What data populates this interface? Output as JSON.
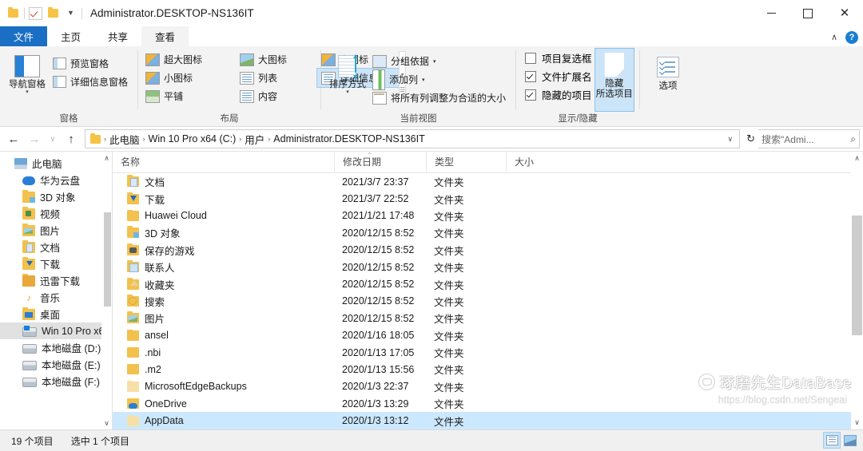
{
  "window": {
    "title": "Administrator.DESKTOP-NS136IT",
    "controls": {
      "minimize": "—",
      "maximize": "□",
      "close": "✕"
    }
  },
  "quick_access_toolbar": {
    "items": [
      "folder-icon",
      "properties-check-icon",
      "new-folder-icon",
      "customize-caret"
    ]
  },
  "tabs": [
    {
      "label": "文件",
      "name": "tab-file"
    },
    {
      "label": "主页",
      "name": "tab-home"
    },
    {
      "label": "共享",
      "name": "tab-share"
    },
    {
      "label": "查看",
      "name": "tab-view"
    }
  ],
  "tabstrip_right": {
    "collapse": "∧",
    "help": "?"
  },
  "ribbon": {
    "groups": [
      {
        "label": "窗格",
        "big_button": {
          "label": "导航窗格",
          "caret": "▾"
        },
        "small_items": [
          {
            "label": "预览窗格"
          },
          {
            "label": "详细信息窗格"
          }
        ]
      },
      {
        "label": "布局",
        "views": [
          {
            "label": "超大图标"
          },
          {
            "label": "大图标"
          },
          {
            "label": "中图标"
          },
          {
            "label": "小图标"
          },
          {
            "label": "列表"
          },
          {
            "label": "详细信息"
          },
          {
            "label": "平铺"
          },
          {
            "label": "内容"
          }
        ],
        "selected_view": "详细信息",
        "scroll": {
          "up": "▴",
          "down": "▾",
          "more": "☰"
        }
      },
      {
        "label": "当前视图",
        "big_button": {
          "label": "排序方式",
          "caret": "▾"
        },
        "small_items": [
          {
            "label": "分组依据",
            "caret": "▾"
          },
          {
            "label": "添加列",
            "caret": "▾"
          },
          {
            "label": "将所有列调整为合适的大小",
            "caret": ""
          }
        ]
      },
      {
        "label": "显示/隐藏",
        "checkboxes": [
          {
            "label": "项目复选框",
            "checked": false
          },
          {
            "label": "文件扩展名",
            "checked": true
          },
          {
            "label": "隐藏的项目",
            "checked": true
          }
        ],
        "hide_button": {
          "line1": "隐藏",
          "line2": "所选项目"
        }
      },
      {
        "label": "",
        "options_button": {
          "label": "选项"
        }
      }
    ]
  },
  "address_bar": {
    "back": "←",
    "forward": "→",
    "recent": "∨",
    "up": "↑",
    "breadcrumbs": [
      "此电脑",
      "Win 10 Pro x64 (C:)",
      "用户",
      "Administrator.DESKTOP-NS136IT"
    ],
    "separator": "›",
    "dropdown_caret": "∨",
    "refresh": "↻",
    "search_value": "搜索\"Admi...",
    "search_icon": "⌕"
  },
  "sidebar": {
    "items": [
      {
        "label": "此电脑",
        "icon": "pc-icon",
        "indent": false,
        "selected": false
      },
      {
        "label": "华为云盘",
        "icon": "cloud-icon",
        "indent": true,
        "selected": false
      },
      {
        "label": "3D 对象",
        "icon": "folder-3d-icon",
        "indent": true,
        "selected": false
      },
      {
        "label": "视频",
        "icon": "folder-video-icon",
        "indent": true,
        "selected": false
      },
      {
        "label": "图片",
        "icon": "folder-pictures-icon",
        "indent": true,
        "selected": false
      },
      {
        "label": "文档",
        "icon": "folder-documents-icon",
        "indent": true,
        "selected": false
      },
      {
        "label": "下载",
        "icon": "folder-downloads-icon",
        "indent": true,
        "selected": false
      },
      {
        "label": "迅雷下载",
        "icon": "folder-thunder-icon",
        "indent": true,
        "selected": false
      },
      {
        "label": "音乐",
        "icon": "music-icon",
        "indent": true,
        "selected": false
      },
      {
        "label": "桌面",
        "icon": "folder-desktop-icon",
        "indent": true,
        "selected": false
      },
      {
        "label": "Win 10 Pro x6",
        "icon": "drive-windows-icon",
        "indent": true,
        "selected": true
      },
      {
        "label": "本地磁盘 (D:)",
        "icon": "drive-icon",
        "indent": true,
        "selected": false
      },
      {
        "label": "本地磁盘 (E:)",
        "icon": "drive-icon",
        "indent": true,
        "selected": false
      },
      {
        "label": "本地磁盘 (F:)",
        "icon": "drive-icon",
        "indent": true,
        "selected": false
      }
    ],
    "scroll_up": "∧",
    "scroll_down": "∨"
  },
  "file_list": {
    "columns": [
      {
        "label": "名称",
        "key": "name"
      },
      {
        "label": "修改日期",
        "key": "date"
      },
      {
        "label": "类型",
        "key": "type"
      },
      {
        "label": "大小",
        "key": "size"
      }
    ],
    "sort_indicator": "⌃",
    "rows": [
      {
        "name": "文档",
        "date": "2021/3/7 23:37",
        "type": "文件夹",
        "size": "",
        "icon": "folder-documents-icon",
        "selected": false
      },
      {
        "name": "下载",
        "date": "2021/3/7 22:52",
        "type": "文件夹",
        "size": "",
        "icon": "folder-downloads-icon",
        "selected": false
      },
      {
        "name": "Huawei Cloud",
        "date": "2021/1/21 17:48",
        "type": "文件夹",
        "size": "",
        "icon": "folder-icon",
        "selected": false
      },
      {
        "name": "3D 对象",
        "date": "2020/12/15 8:52",
        "type": "文件夹",
        "size": "",
        "icon": "folder-3d-icon",
        "selected": false
      },
      {
        "name": "保存的游戏",
        "date": "2020/12/15 8:52",
        "type": "文件夹",
        "size": "",
        "icon": "folder-games-icon",
        "selected": false
      },
      {
        "name": "联系人",
        "date": "2020/12/15 8:52",
        "type": "文件夹",
        "size": "",
        "icon": "folder-contacts-icon",
        "selected": false
      },
      {
        "name": "收藏夹",
        "date": "2020/12/15 8:52",
        "type": "文件夹",
        "size": "",
        "icon": "folder-favorites-icon",
        "selected": false
      },
      {
        "name": "搜索",
        "date": "2020/12/15 8:52",
        "type": "文件夹",
        "size": "",
        "icon": "folder-searches-icon",
        "selected": false
      },
      {
        "name": "图片",
        "date": "2020/12/15 8:52",
        "type": "文件夹",
        "size": "",
        "icon": "folder-pictures-icon",
        "selected": false
      },
      {
        "name": "ansel",
        "date": "2020/1/16 18:05",
        "type": "文件夹",
        "size": "",
        "icon": "folder-icon",
        "selected": false
      },
      {
        "name": ".nbi",
        "date": "2020/1/13 17:05",
        "type": "文件夹",
        "size": "",
        "icon": "folder-icon",
        "selected": false
      },
      {
        "name": ".m2",
        "date": "2020/1/13 15:56",
        "type": "文件夹",
        "size": "",
        "icon": "folder-icon",
        "selected": false
      },
      {
        "name": "MicrosoftEdgeBackups",
        "date": "2020/1/3 22:37",
        "type": "文件夹",
        "size": "",
        "icon": "folder-hidden-icon",
        "selected": false
      },
      {
        "name": "OneDrive",
        "date": "2020/1/3 13:29",
        "type": "文件夹",
        "size": "",
        "icon": "folder-onedrive-icon",
        "selected": false
      },
      {
        "name": "AppData",
        "date": "2020/1/3 13:12",
        "type": "文件夹",
        "size": "",
        "icon": "folder-hidden-icon",
        "selected": true
      }
    ],
    "scroll_up": "∧",
    "scroll_down": "∨"
  },
  "status_bar": {
    "item_count": "19 个项目",
    "selection": "选中 1 个项目",
    "view_buttons": [
      "details-view-icon",
      "large-icons-view-icon"
    ]
  },
  "watermark": {
    "name": "琢磨先生DataBase",
    "url": "https://blog.csdn.net/Sengeai"
  },
  "colors": {
    "accent": "#1a6fc4",
    "selection": "#cce8ff",
    "ribbon_bg": "#f3f3f3",
    "folder_yellow": "#f2c14e",
    "help_blue": "#1a7fd4"
  }
}
